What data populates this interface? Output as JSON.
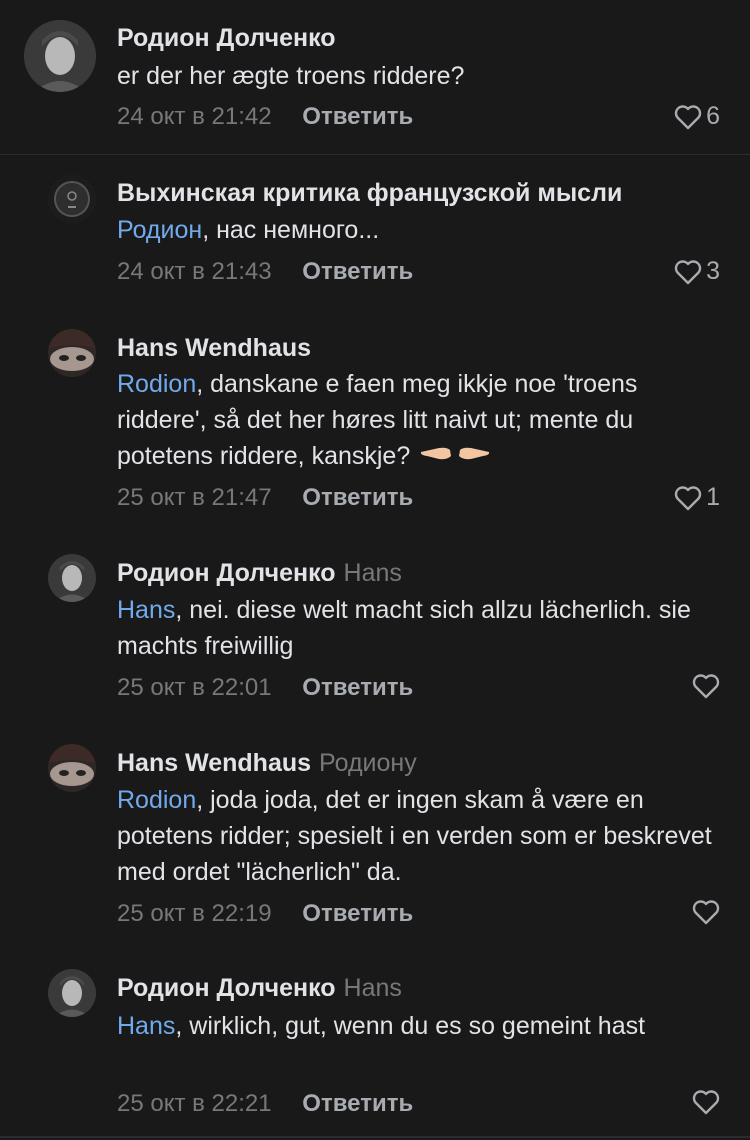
{
  "comments": [
    {
      "author": "Родион Долченко",
      "reply_to": "",
      "mention": "",
      "text": "er der her ægte troens riddere?",
      "date": "24 окт в 21:42",
      "reply_label": "Ответить",
      "likes": "6"
    },
    {
      "author": "Выхинская критика французской мысли",
      "reply_to": "",
      "mention": "Родион",
      "text": ", нас немного...",
      "date": "24 окт в 21:43",
      "reply_label": "Ответить",
      "likes": "3"
    },
    {
      "author": "Hans Wendhaus",
      "reply_to": "",
      "mention": "Rodion",
      "text": ", danskane e faen meg ikkje noe 'troens riddere', så det her høres litt naivt ut; mente du potetens riddere, kanskje?",
      "date": "25 окт в 21:47",
      "reply_label": "Ответить",
      "likes": "1"
    },
    {
      "author": "Родион Долченко",
      "reply_to": "Hans",
      "mention": "Hans",
      "text": ", nei. diese welt macht sich allzu lächerlich. sie machts freiwillig",
      "date": "25 окт в 22:01",
      "reply_label": "Ответить",
      "likes": ""
    },
    {
      "author": "Hans Wendhaus",
      "reply_to": "Родиону",
      "mention": "Rodion",
      "text": ", joda joda, det er ingen skam å være en potetens ridder; spesielt i en verden som er beskrevet med ordet \"lächerlich\" da.",
      "date": "25 окт в 22:19",
      "reply_label": "Ответить",
      "likes": ""
    },
    {
      "author": "Родион Долченко",
      "reply_to": "Hans",
      "mention": "Hans",
      "text": ",  wirklich, gut, wenn du es so gemeint hast",
      "date": "25 окт в 22:21",
      "reply_label": "Ответить",
      "likes": ""
    }
  ],
  "icons": {
    "like": "heart-outline-icon",
    "emoji": "pointing-hands-emoji"
  },
  "colors": {
    "background": "#19191a",
    "text": "#e1e3e6",
    "secondary": "#76787a",
    "mention": "#71aaeb"
  }
}
